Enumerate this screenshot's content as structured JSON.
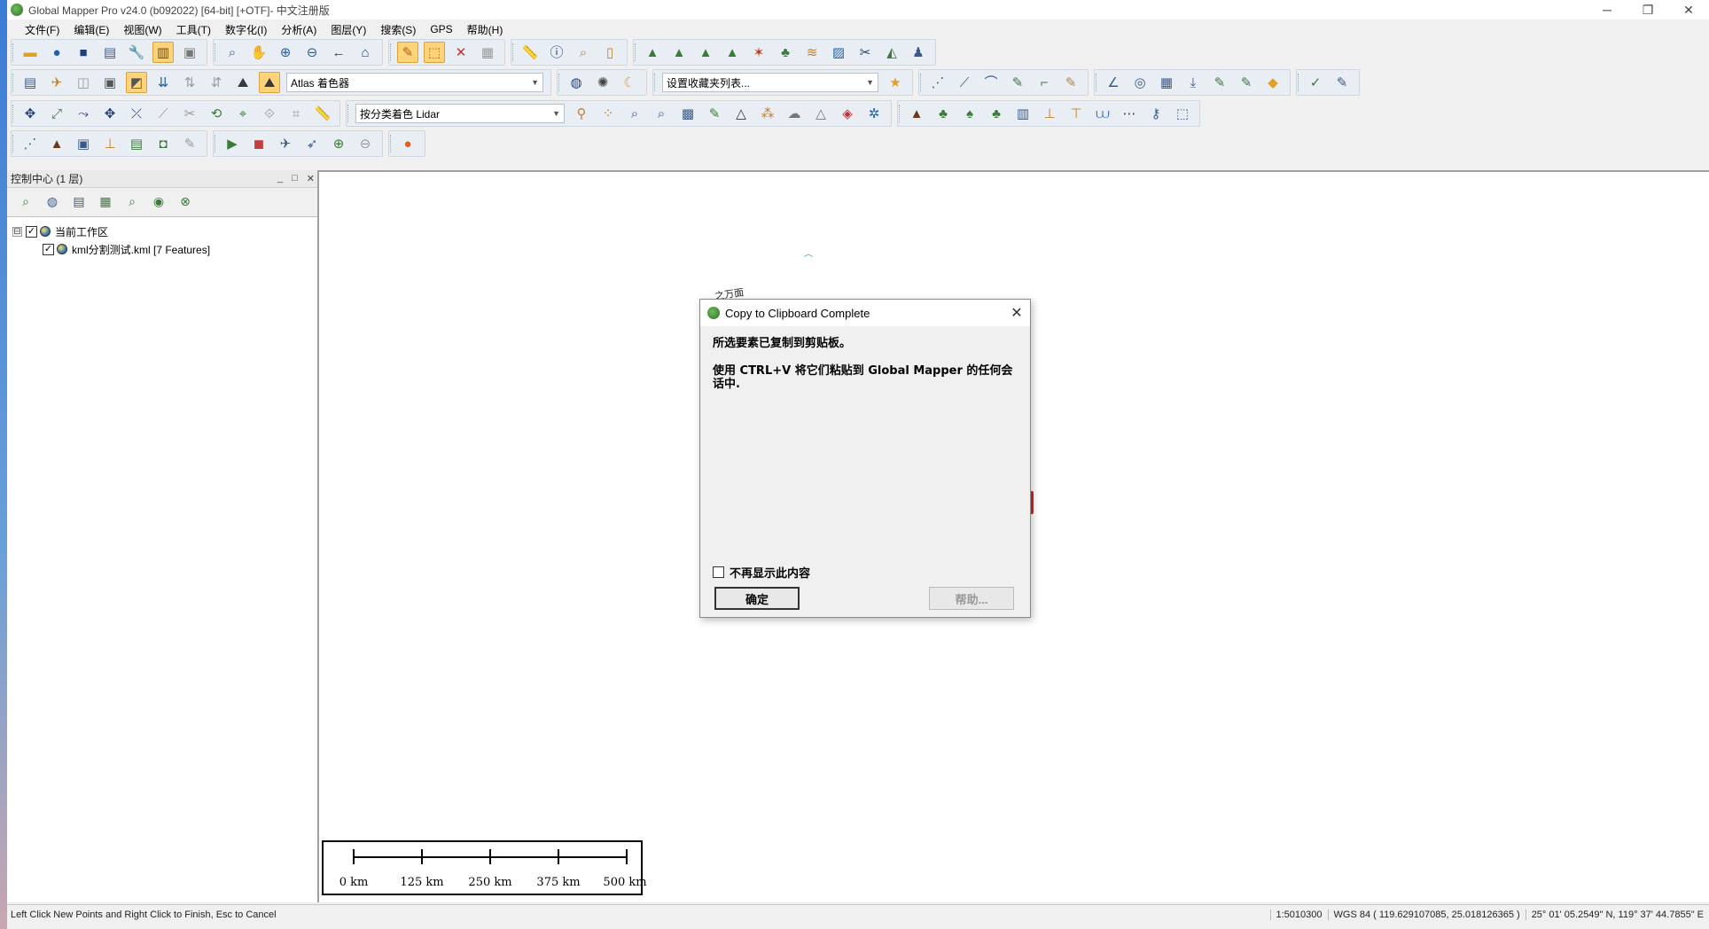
{
  "window": {
    "title": "Global Mapper Pro v24.0 (b092022) [64-bit] [+OTF]- 中文注册版",
    "minimize": "─",
    "restore": "❐",
    "close": "✕"
  },
  "menu": [
    "文件(F)",
    "编辑(E)",
    "视图(W)",
    "工具(T)",
    "数字化(I)",
    "分析(A)",
    "图层(Y)",
    "搜索(S)",
    "GPS",
    "帮助(H)"
  ],
  "toolbar": {
    "shader_select": "Atlas 着色器",
    "favorites_select": "设置收藏夹列表...",
    "lidar_select": "按分类着色 Lidar"
  },
  "control_center": {
    "title": "控制中心 (1 层)",
    "minimize": "_",
    "float": "□",
    "close": "✕",
    "tree": {
      "root_label": "当前工作区",
      "root_expander": "⊟",
      "layer_label": "kml分割测试.kml [7 Features]",
      "root_checked": "✓",
      "layer_checked": "✓"
    }
  },
  "map": {
    "fragment_text": "_之万面",
    "scale": {
      "labels": [
        "0 km",
        "125 km",
        "250 km",
        "375 km",
        "500 km"
      ]
    }
  },
  "dialog": {
    "title": "Copy to Clipboard Complete",
    "close": "✕",
    "line1": "所选要素已复制到剪贴板。",
    "line2": "使用 CTRL+V 将它们粘贴到 Global Mapper 的任何会话中.",
    "dont_show_label": "不再显示此内容",
    "ok_label": "确定",
    "help_label": "帮助..."
  },
  "status": {
    "message": "Left Click New Points and Right Click to Finish, Esc to Cancel",
    "scale": "1:5010300",
    "coords": "WGS 84 ( 119.629107085, 25.018126365 )",
    "dms": "25° 01' 05.2549\" N, 119° 37' 44.7855\" E"
  },
  "colors": {
    "accent_active": "#ffd37a",
    "toolbar_bg": "#e9eef4"
  }
}
